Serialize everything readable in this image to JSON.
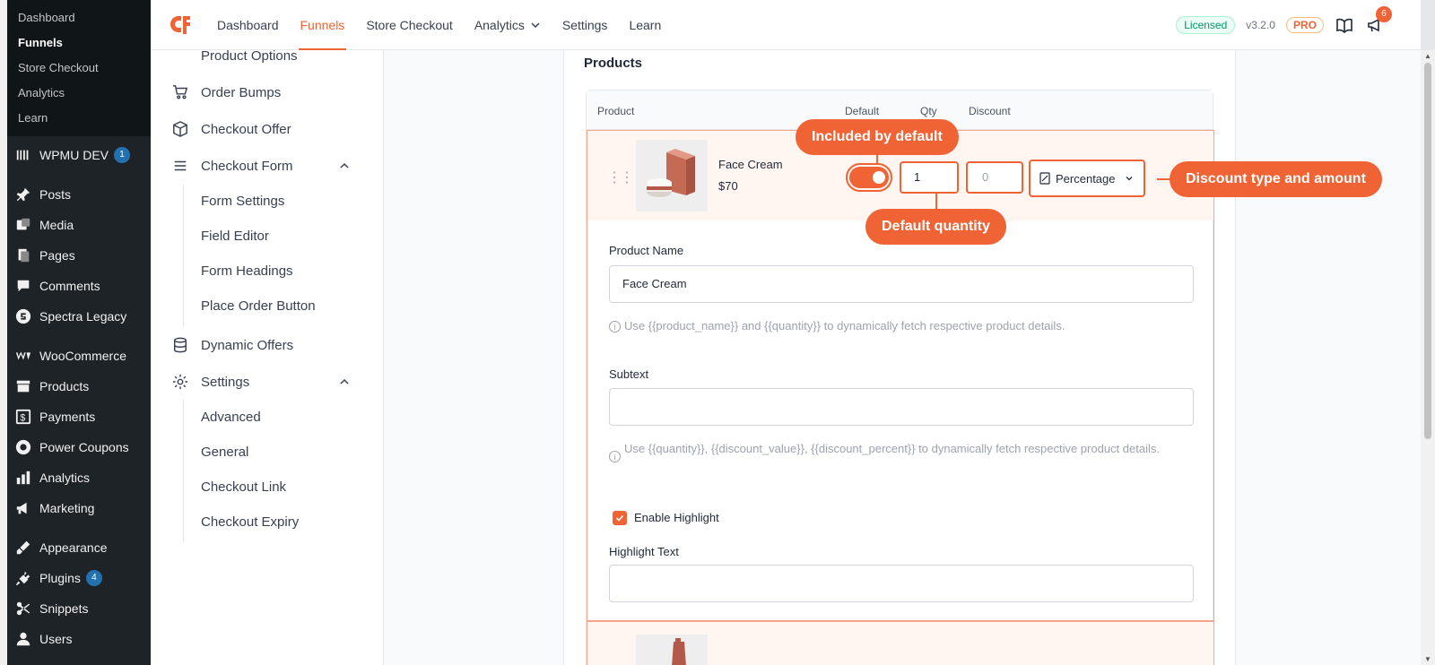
{
  "wp": {
    "submenu": [
      "Dashboard",
      "Funnels",
      "Store Checkout",
      "Analytics",
      "Learn"
    ],
    "menu": {
      "wpmudev": "WPMU DEV",
      "wpmudev_badge": "1",
      "posts": "Posts",
      "media": "Media",
      "pages": "Pages",
      "comments": "Comments",
      "spectra": "Spectra Legacy",
      "woocommerce": "WooCommerce",
      "products": "Products",
      "payments": "Payments",
      "coupons": "Power Coupons",
      "analytics": "Analytics",
      "marketing": "Marketing",
      "appearance": "Appearance",
      "plugins": "Plugins",
      "plugins_badge": "4",
      "snippets": "Snippets",
      "users": "Users"
    }
  },
  "topnav": {
    "items": [
      "Dashboard",
      "Funnels",
      "Store Checkout",
      "Analytics",
      "Settings",
      "Learn"
    ],
    "licensed": "Licensed",
    "version": "v3.2.0",
    "pro": "PRO",
    "notifications": "6"
  },
  "setnav": {
    "product_options": "Product Options",
    "order_bumps": "Order Bumps",
    "checkout_offer": "Checkout Offer",
    "checkout_form": "Checkout Form",
    "form_settings": "Form Settings",
    "field_editor": "Field Editor",
    "form_headings": "Form Headings",
    "place_order": "Place Order Button",
    "dynamic_offers": "Dynamic Offers",
    "settings": "Settings",
    "advanced": "Advanced",
    "general": "General",
    "checkout_link": "Checkout Link",
    "checkout_expiry": "Checkout Expiry"
  },
  "products": {
    "title": "Products",
    "headers": {
      "product": "Product",
      "default": "Default",
      "qty": "Qty",
      "discount": "Discount"
    },
    "row": {
      "name": "Face Cream",
      "price": "$70",
      "qty": "1",
      "discount_placeholder": "0",
      "discount_type": "Percentage"
    },
    "form": {
      "product_name_label": "Product Name",
      "product_name_value": "Face Cream",
      "product_name_hint": "Use {{product_name}} and {{quantity}} to dynamically fetch respective product details.",
      "subtext_label": "Subtext",
      "subtext_hint": "Use {{quantity}}, {{discount_value}}, {{discount_percent}} to dynamically fetch respective product details.",
      "enable_highlight": "Enable Highlight",
      "highlight_text_label": "Highlight Text"
    }
  },
  "callouts": {
    "default": "Included by default",
    "qty": "Default quantity",
    "discount": "Discount type and amount"
  },
  "colors": {
    "accent": "#f06335",
    "wp_sidebar": "#1d2327"
  }
}
